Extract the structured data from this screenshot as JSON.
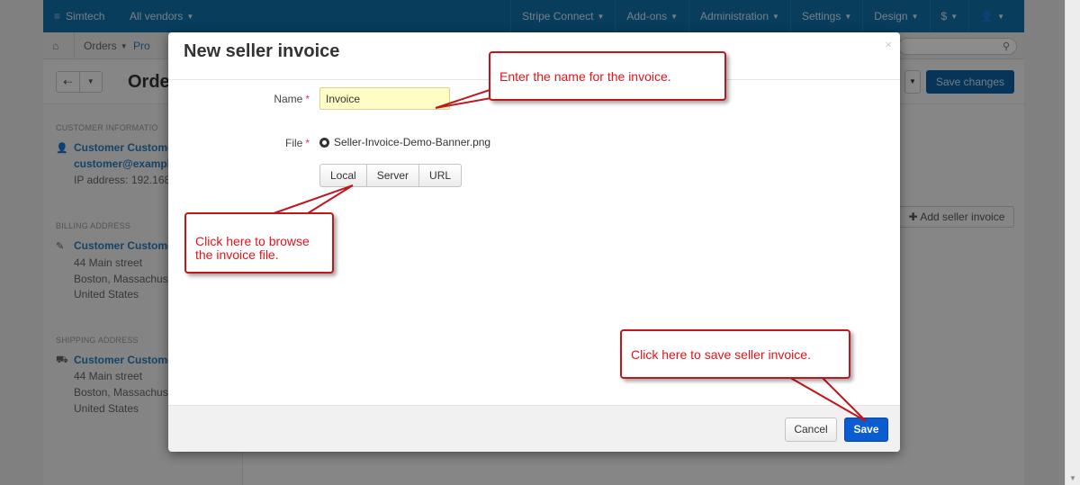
{
  "topbar": {
    "brand": "Simtech",
    "vendors": "All vendors",
    "nav": [
      "Stripe Connect",
      "Add-ons",
      "Administration",
      "Settings",
      "Design",
      "$",
      ""
    ]
  },
  "breadcrumb": {
    "orders": "Orders",
    "current": "Pro"
  },
  "page": {
    "title": "Orde",
    "save_changes": "Save changes",
    "add_seller_invoice": "Add seller invoice"
  },
  "sidebar": {
    "customer_info_header": "CUSTOMER INFORMATIO",
    "customer_name": "Customer Custome",
    "customer_email": "customer@exampl",
    "ip_address": "IP address: 192.168",
    "billing_header": "BILLING ADDRESS",
    "billing_name": "Customer Custome",
    "billing_street": "44 Main street",
    "billing_city": "Boston, Massachus",
    "billing_country": "United States",
    "shipping_header": "SHIPPING ADDRESS",
    "shipping_name": "Customer Custome",
    "shipping_street": "44 Main street",
    "shipping_city": "Boston, Massachus",
    "shipping_country": "United States"
  },
  "modal": {
    "title": "New seller invoice",
    "close": "×",
    "name_label": "Name",
    "name_value": "Invoice",
    "file_label": "File",
    "file_name": "Seller-Invoice-Demo-Banner.png",
    "upload_options": [
      "Local",
      "Server",
      "URL"
    ],
    "cancel": "Cancel",
    "save": "Save",
    "required_mark": "*"
  },
  "callouts": {
    "name_hint": "Enter the name for the invoice.",
    "browse_hint": "Click here to browse the invoice file.",
    "save_hint": "Click here to save seller invoice."
  },
  "colors": {
    "topbar": "#0f6fa8",
    "callout_red": "#e3141b",
    "save_blue": "#0b5cd1"
  }
}
